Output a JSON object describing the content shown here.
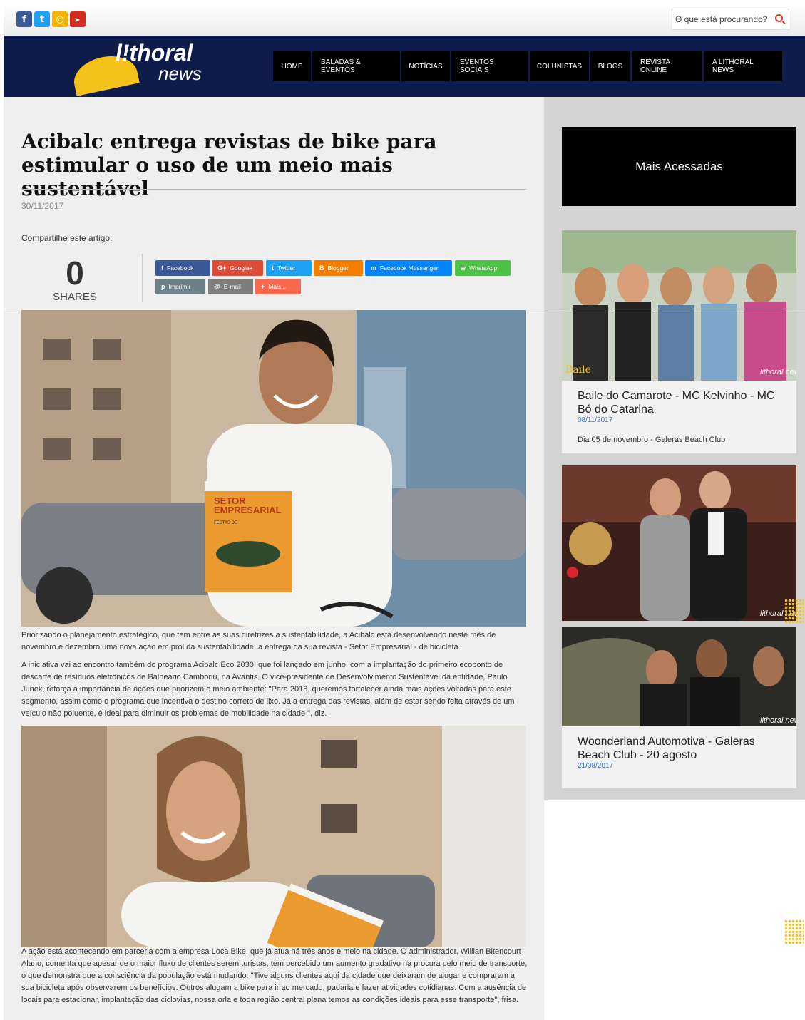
{
  "search": {
    "placeholder": "O que está procurando?"
  },
  "social_icons": [
    "facebook-icon",
    "twitter-icon",
    "instagram-icon",
    "youtube-icon"
  ],
  "logo": {
    "brand": "l!thoral",
    "sub": "news"
  },
  "nav": [
    "HOME",
    "BALADAS & EVENTOS",
    "NOTÍCIAS",
    "EVENTOS SOCIAIS",
    "COLUNISTAS",
    "BLOGS",
    "REVISTA ONLINE",
    "A LITHORAL NEWS"
  ],
  "article": {
    "title": "Acibalc entrega revistas de bike para estimular o uso de um meio mais sustentável",
    "date": "30/11/2017",
    "share_label": "Compartilhe este artigo:",
    "share_count": "0",
    "share_count_label": "SHARES",
    "share_buttons": [
      {
        "label": "Facebook",
        "icon": "f",
        "color": "#3b5998"
      },
      {
        "label": "Google+",
        "icon": "G+",
        "color": "#dd4b39"
      },
      {
        "label": "Twitter",
        "icon": "t",
        "color": "#1da1f2"
      },
      {
        "label": "Blogger",
        "icon": "B",
        "color": "#f57d00"
      },
      {
        "label": "Facebook Messenger",
        "icon": "m",
        "color": "#0084ff"
      },
      {
        "label": "WhatsApp",
        "icon": "w",
        "color": "#4dc247"
      },
      {
        "label": "Imprimir",
        "icon": "p",
        "color": "#6d8088"
      },
      {
        "label": "E-mail",
        "icon": "@",
        "color": "#7d7d7d"
      },
      {
        "label": "Mais...",
        "icon": "+",
        "color": "#f8694d"
      }
    ],
    "paragraphs": [
      "Priorizando o planejamento estratégico, que tem entre as suas diretrizes a sustentabilidade, a Acibalc está desenvolvendo neste mês de novembro e dezembro uma nova ação em prol da sustentabilidade: a entrega da sua revista - Setor Empresarial - de bicicleta.",
      "A iniciativa vai ao encontro também do programa Acibalc Eco 2030, que foi lançado em junho, com a implantação do primeiro ecoponto de descarte de resíduos eletrônicos de Balneário Camboriú, na Avantis. O vice-presidente de Desenvolvimento Sustentável da entidade, Paulo Junek, reforça a importância de ações que priorizem o meio ambiente: \"Para 2018, queremos fortalecer ainda mais ações voltadas para este segmento, assim como o programa que incentiva o destino correto de lixo. Já a entrega das revistas, além de estar sendo feita através de um veículo não poluente, é ideal para diminuir os problemas de mobilidade na cidade \", diz.",
      "A ação está acontecendo em parceria com a empresa Loca Bike, que já atua há três anos e meio na cidade. O administrador, Willian Bitencourt Alano, comenta que apesar de o maior fluxo de clientes serem turistas, tem percebido um aumento gradativo na procura pelo meio de transporte, o que demonstra que a consciência da população está mudando. \"Tive alguns clientes aqui da cidade que deixaram de alugar e compraram a sua bicicleta após observarem os benefícios. Outros alugam a bike para ir ao mercado, padaria e fazer atividades cotidianas. Com a ausência de locais para estacionar, implantação das ciclovias, nossa orla e toda região central plana temos as condições ideais para esse transporte\", frisa."
    ],
    "magazine_text": {
      "line1": "SETOR",
      "line2": "EMPRESARIAL",
      "line3": "FESTAS DE"
    }
  },
  "sidebar": {
    "heading": "Mais Acessadas",
    "cards": [
      {
        "title": "Baile do Camarote - MC Kelvinho - MC Bó do Catarina",
        "date": "08/11/2017",
        "desc": "Dia 05 de novembro - Galeras Beach Club"
      },
      {
        "title": "",
        "date": "",
        "desc": ""
      },
      {
        "title": "Woonderland Automotiva - Galeras Beach Club - 20 agosto",
        "date": "21/08/2017",
        "desc": ""
      }
    ],
    "watermark": "lithoral news"
  }
}
